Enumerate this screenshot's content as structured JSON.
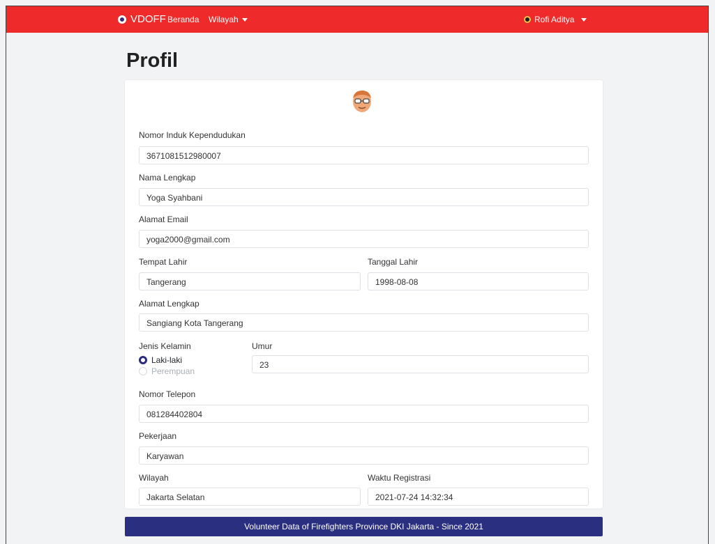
{
  "navbar": {
    "brand": "VDOFF",
    "links": [
      {
        "label": "Beranda"
      },
      {
        "label": "Wilayah"
      }
    ],
    "user": "Rofi Aditya",
    "color": "#ee2a2a"
  },
  "page": {
    "title": "Profil"
  },
  "form": {
    "nik": {
      "label": "Nomor Induk Kependudukan",
      "value": "3671081512980007"
    },
    "nama": {
      "label": "Nama Lengkap",
      "value": "Yoga Syahbani"
    },
    "email": {
      "label": "Alamat Email",
      "value": "yoga2000@gmail.com"
    },
    "tempat_lahir": {
      "label": "Tempat Lahir",
      "value": "Tangerang"
    },
    "tanggal_lahir": {
      "label": "Tanggal Lahir",
      "value": "1998-08-08"
    },
    "alamat": {
      "label": "Alamat Lengkap",
      "value": "Sangiang Kota Tangerang"
    },
    "jenis_kelamin": {
      "label": "Jenis Kelamin",
      "options": [
        "Laki-laki",
        "Perempuan"
      ],
      "selected": "Laki-laki"
    },
    "umur": {
      "label": "Umur",
      "value": "23"
    },
    "telepon": {
      "label": "Nomor Telepon",
      "value": "081284402804"
    },
    "pekerjaan": {
      "label": "Pekerjaan",
      "value": "Karyawan"
    },
    "wilayah": {
      "label": "Wilayah",
      "value": "Jakarta Selatan"
    },
    "waktu_registrasi": {
      "label": "Waktu Registrasi",
      "value": "2021-07-24 14:32:34"
    }
  },
  "footer": {
    "text": "Volunteer Data of Firefighters Province DKI Jakarta - Since 2021",
    "color": "#2b2f80"
  }
}
